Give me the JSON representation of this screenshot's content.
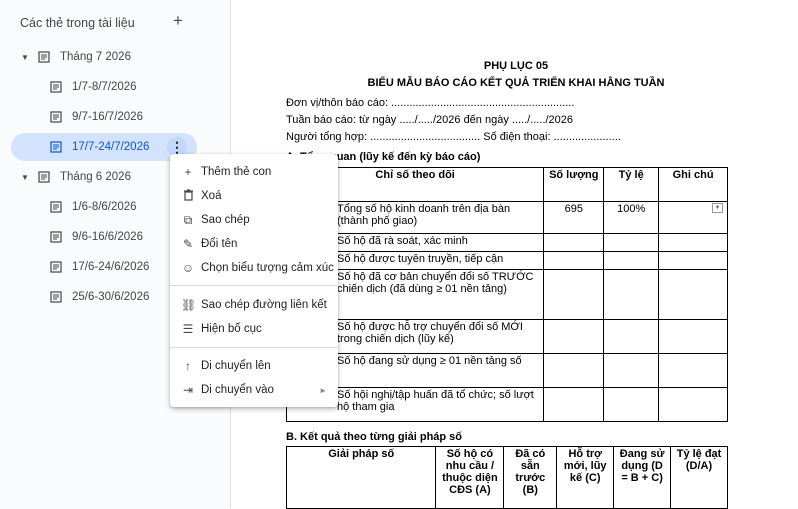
{
  "sidebar": {
    "header": "Các thẻ trong tài liệu",
    "add_symbol": "+",
    "tabs": [
      {
        "label": "Tháng 7 2026"
      },
      {
        "label": "1/7-8/7/2026"
      },
      {
        "label": "9/7-16/7/2026"
      },
      {
        "label": "17/7-24/7/2026"
      },
      {
        "label": "Tháng 6 2026"
      },
      {
        "label": "1/6-8/6/2026"
      },
      {
        "label": "9/6-16/6/2026"
      },
      {
        "label": "17/6-24/6/2026"
      },
      {
        "label": "25/6-30/6/2026"
      }
    ],
    "more_symbol": "⋮"
  },
  "context_menu": {
    "items": [
      {
        "icon": "plus-icon",
        "glyph": "+",
        "label": "Thêm thẻ con"
      },
      {
        "icon": "trash-icon",
        "glyph": "🗑",
        "label": "Xoá"
      },
      {
        "icon": "copy-icon",
        "glyph": "⧉",
        "label": "Sao chép"
      },
      {
        "icon": "pencil-icon",
        "glyph": "✎",
        "label": "Đổi tên"
      },
      {
        "icon": "emoji-icon",
        "glyph": "☺",
        "label": "Chọn biểu tượng cảm xúc"
      },
      {
        "icon": "link-icon",
        "glyph": "⛓",
        "label": "Sao chép đường liên kết"
      },
      {
        "icon": "outline-icon",
        "glyph": "☰",
        "label": "Hiện bố cục"
      },
      {
        "icon": "arrow-up-icon",
        "glyph": "↑",
        "label": "Di chuyển lên"
      },
      {
        "icon": "move-into-icon",
        "glyph": "⇥",
        "label": "Di chuyển vào"
      }
    ],
    "submenu_arrow": "►"
  },
  "document": {
    "appendix": "PHỤ LỤC 05",
    "title": "BIỂU MẪU BÁO CÁO KẾT QUẢ TRIỂN KHAI HẰNG TUẦN",
    "unit_line": "Đơn vị/thôn báo cáo: ............................................................",
    "week_line": "Tuần báo cáo: từ ngày ...../...../2026 đến ngày ...../...../2026",
    "reporter_line": "Người tổng hợp: ....................................   Số điện thoại: ......................",
    "section_a": "A. Tổng quan (lũy kế đến kỳ báo cáo)",
    "table_a": {
      "headers": [
        "Chỉ số theo dõi",
        "Số lượng",
        "Tỷ lệ",
        "Ghi chú"
      ],
      "rows": [
        {
          "indicator": "Tổng số hộ kinh doanh trên địa bàn (thành phố giao)",
          "qty": "695",
          "rate": "100%",
          "note": ""
        },
        {
          "indicator": "Số hộ đã rà soát, xác minh",
          "qty": "",
          "rate": "",
          "note": ""
        },
        {
          "indicator": "Số hộ được tuyên truyền, tiếp cận",
          "qty": "",
          "rate": "",
          "note": ""
        },
        {
          "indicator": "Số hộ đã cơ bản chuyển đổi số TRƯỚC chiến dịch (đã dùng ≥ 01 nền tảng)",
          "qty": "",
          "rate": "",
          "note": ""
        },
        {
          "indicator": "Số hộ được hỗ trợ chuyển đổi số MỚI trong chiến dịch (lũy kế)",
          "qty": "",
          "rate": "",
          "note": ""
        },
        {
          "indicator": "Số hộ đang sử dụng ≥ 01 nền tảng số",
          "qty": "",
          "rate": "",
          "note": ""
        },
        {
          "indicator": "Số hội nghị/tập huấn đã tổ chức; số lượt hộ tham gia",
          "qty": "",
          "rate": "",
          "note": ""
        }
      ]
    },
    "section_b": "B. Kết quả theo từng giải pháp số",
    "table_b": {
      "headers": [
        "Giải pháp số",
        "Số hộ có nhu cầu / thuộc diện CĐS (A)",
        "Đã có sẵn trước (B)",
        "Hỗ trợ mới, lũy kế (C)",
        "Đang sử dụng (D = B + C)",
        "Tỷ lệ đạt (D/A)"
      ]
    }
  }
}
